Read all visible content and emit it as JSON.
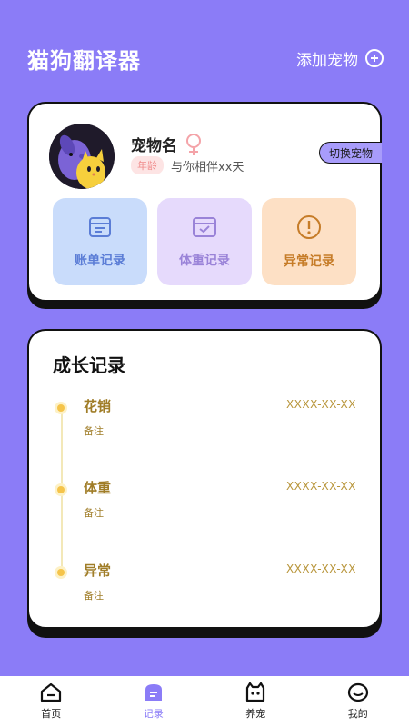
{
  "header": {
    "title": "猫狗翻译器",
    "add_pet_label": "添加宠物"
  },
  "pet_card": {
    "pet_name": "宠物名",
    "age_badge": "年龄",
    "companion_text": "与你相伴xx天",
    "switch_label": "切换宠物",
    "actions": [
      {
        "label": "账单记录",
        "icon": "bill-icon"
      },
      {
        "label": "体重记录",
        "icon": "weight-icon"
      },
      {
        "label": "异常记录",
        "icon": "warning-icon"
      }
    ]
  },
  "growth": {
    "title": "成长记录",
    "items": [
      {
        "name": "花销",
        "date": "XXXX-XX-XX",
        "note": "备注"
      },
      {
        "name": "体重",
        "date": "XXXX-XX-XX",
        "note": "备注"
      },
      {
        "name": "异常",
        "date": "XXXX-XX-XX",
        "note": "备注"
      }
    ]
  },
  "nav": {
    "active": "记录",
    "items": [
      {
        "label": "首页",
        "icon": "home-icon"
      },
      {
        "label": "记录",
        "icon": "record-icon"
      },
      {
        "label": "养宠",
        "icon": "pet-care-icon"
      },
      {
        "label": "我的",
        "icon": "profile-icon"
      }
    ]
  },
  "colors": {
    "background": "#8b7cf7",
    "accent": "#8b7cf7",
    "timeline_text": "#a07d28"
  }
}
